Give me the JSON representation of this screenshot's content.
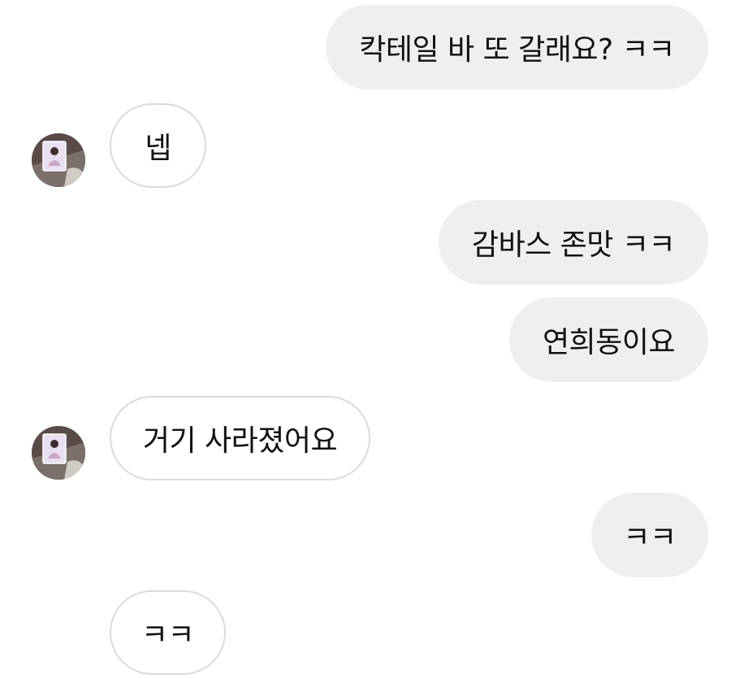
{
  "chat": {
    "messages": [
      {
        "sender": "me",
        "text": "칵테일 바 또 갈래요? ㅋㅋ"
      },
      {
        "sender": "them",
        "text": "넵"
      },
      {
        "sender": "me",
        "text": "감바스 존맛 ㅋㅋ"
      },
      {
        "sender": "me",
        "text": "연희동이요"
      },
      {
        "sender": "them",
        "text": "거기 사라졌어요"
      },
      {
        "sender": "me",
        "text": "ㅋㅋ"
      },
      {
        "sender": "them",
        "text": "ㅋㅋ"
      }
    ],
    "avatar_icon": "profile-photo-avatar",
    "colors": {
      "outgoing_bubble": "#efefef",
      "incoming_bubble": "#ffffff",
      "incoming_border": "#dbdbdb",
      "text": "#111111"
    }
  }
}
